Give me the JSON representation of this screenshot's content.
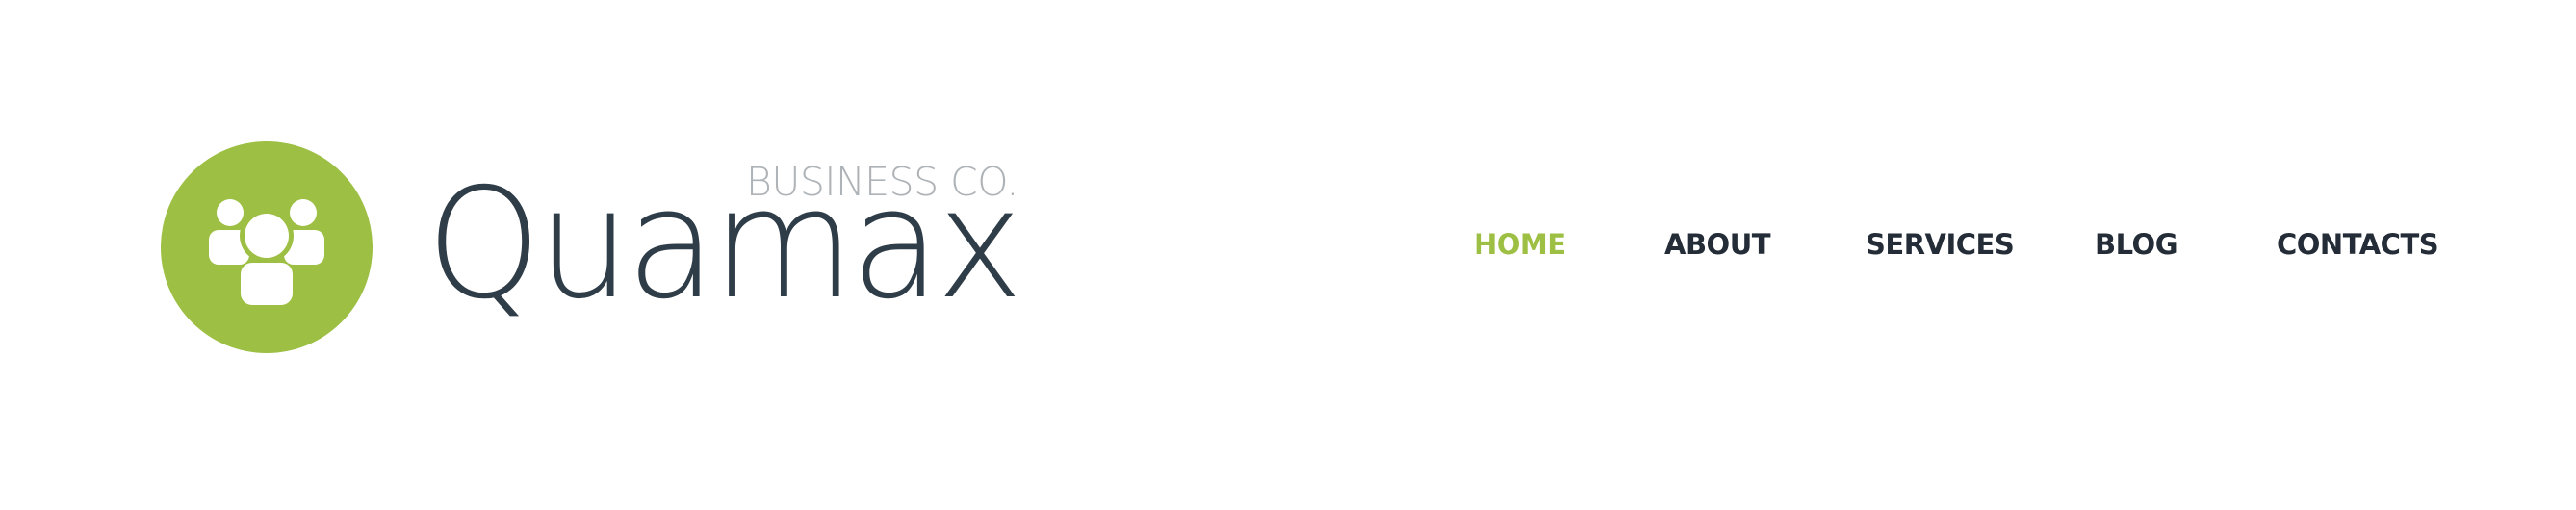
{
  "brand": {
    "tagline": "BUSINESS CO.",
    "name": "Quamax",
    "logo_icon": "users-group-icon",
    "accent_color": "#9dbf44",
    "name_color": "#2f3d49"
  },
  "nav": {
    "items": [
      {
        "label": "HOME",
        "active": true
      },
      {
        "label": "ABOUT",
        "active": false
      },
      {
        "label": "SERVICES",
        "active": false
      },
      {
        "label": "BLOG",
        "active": false
      },
      {
        "label": "CONTACTS",
        "active": false
      }
    ],
    "active_color": "#9dbf44",
    "text_color": "#232c37"
  }
}
